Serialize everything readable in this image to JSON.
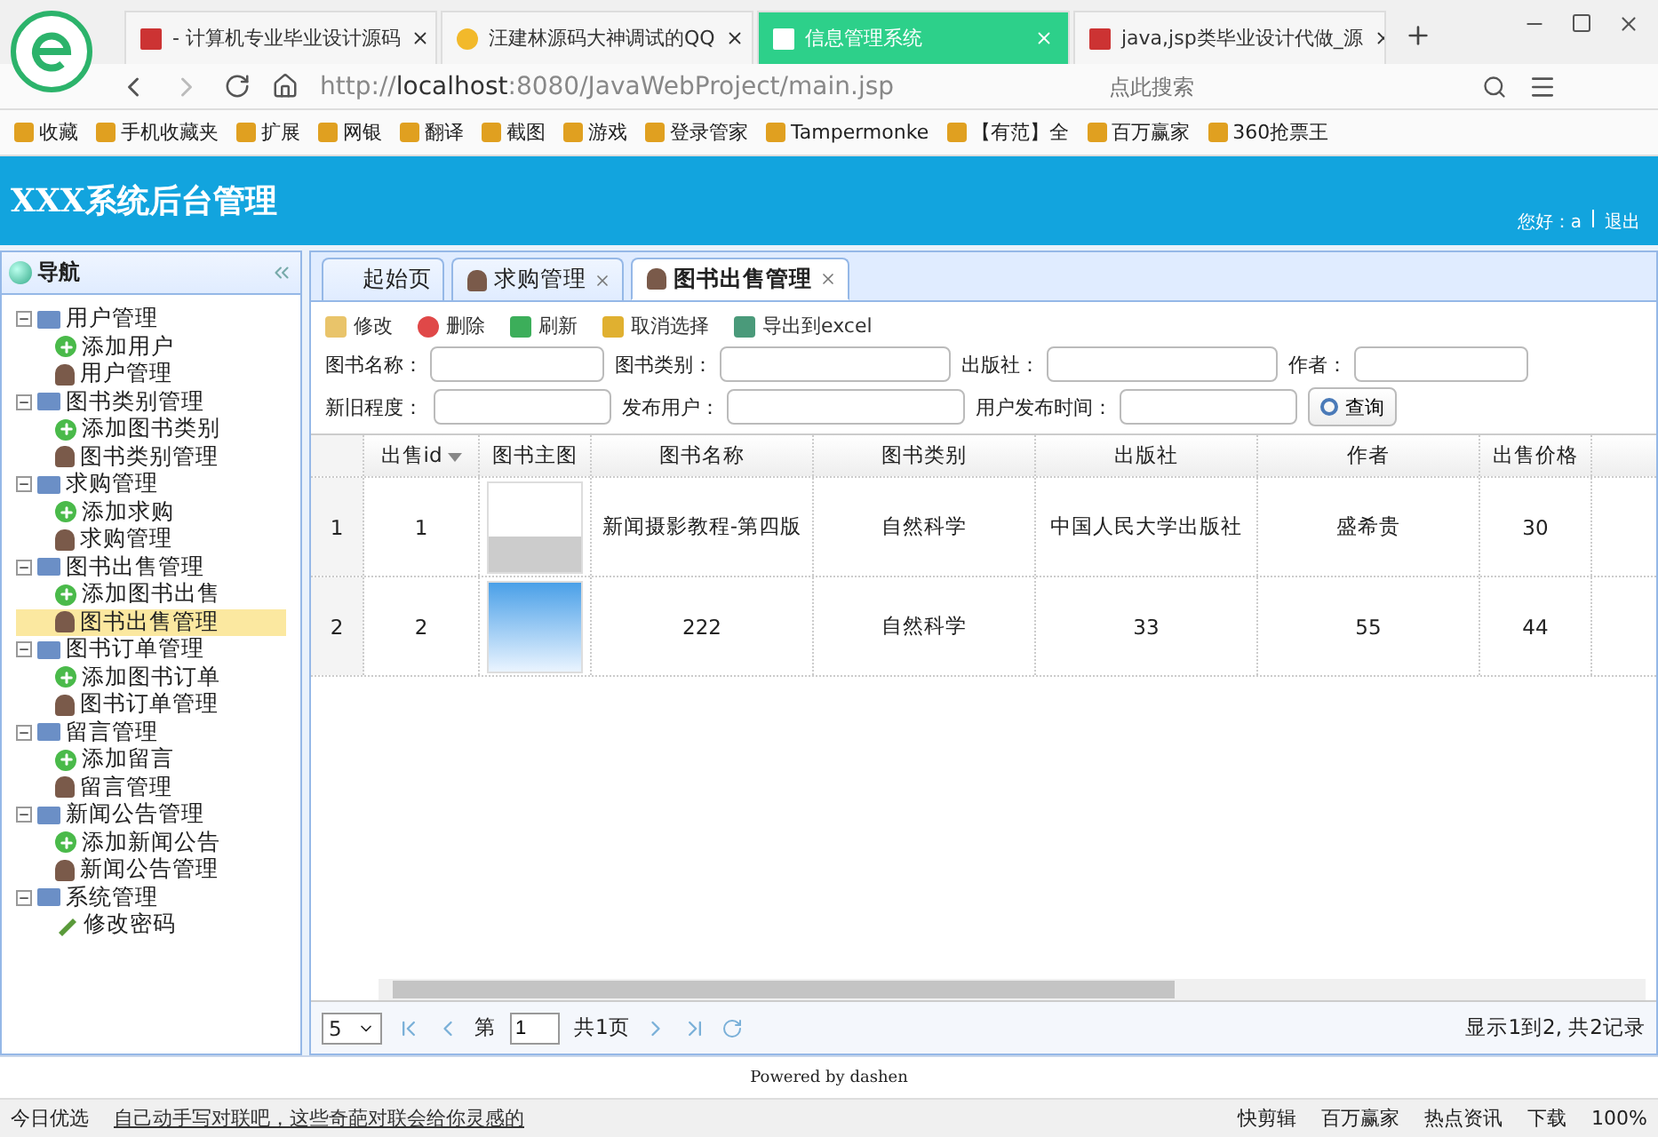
{
  "browser": {
    "tabs": [
      {
        "title": "- 计算机专业毕业设计源码",
        "selected": false,
        "kind": "flag"
      },
      {
        "title": "汪建林源码大神调试的QQ",
        "selected": false,
        "kind": "star"
      },
      {
        "title": "信息管理系统",
        "selected": true,
        "kind": "page"
      },
      {
        "title": "java,jsp类毕业设计代做_源",
        "selected": false,
        "kind": "flag"
      }
    ],
    "url_prefix": "http://",
    "url_host": "localhost",
    "url_rest": ":8080/JavaWebProject/main.jsp",
    "search_placeholder": "点此搜索",
    "bookmarks": [
      "收藏",
      "手机收藏夹",
      "扩展",
      "网银",
      "翻译",
      "截图",
      "游戏",
      "登录管家",
      "Tampermonke",
      "【有范】全",
      "百万赢家",
      "360抢票王"
    ]
  },
  "app": {
    "title": "XXX系统后台管理",
    "greeting": "您好：a",
    "logout": "退出",
    "nav_title": "导航",
    "tree": [
      {
        "label": "用户管理",
        "expanded": true,
        "children": [
          {
            "label": "添加用户",
            "kind": "add",
            "selected": false
          },
          {
            "label": "用户管理",
            "kind": "manage",
            "selected": false
          }
        ]
      },
      {
        "label": "图书类别管理",
        "expanded": true,
        "children": [
          {
            "label": "添加图书类别",
            "kind": "add",
            "selected": false
          },
          {
            "label": "图书类别管理",
            "kind": "manage",
            "selected": false
          }
        ]
      },
      {
        "label": "求购管理",
        "expanded": true,
        "children": [
          {
            "label": "添加求购",
            "kind": "add",
            "selected": false
          },
          {
            "label": "求购管理",
            "kind": "manage",
            "selected": false
          }
        ]
      },
      {
        "label": "图书出售管理",
        "expanded": true,
        "children": [
          {
            "label": "添加图书出售",
            "kind": "add",
            "selected": false
          },
          {
            "label": "图书出售管理",
            "kind": "manage",
            "selected": true
          }
        ]
      },
      {
        "label": "图书订单管理",
        "expanded": true,
        "children": [
          {
            "label": "添加图书订单",
            "kind": "add",
            "selected": false
          },
          {
            "label": "图书订单管理",
            "kind": "manage",
            "selected": false
          }
        ]
      },
      {
        "label": "留言管理",
        "expanded": true,
        "children": [
          {
            "label": "添加留言",
            "kind": "add",
            "selected": false
          },
          {
            "label": "留言管理",
            "kind": "manage",
            "selected": false
          }
        ]
      },
      {
        "label": "新闻公告管理",
        "expanded": true,
        "children": [
          {
            "label": "添加新闻公告",
            "kind": "add",
            "selected": false
          },
          {
            "label": "新闻公告管理",
            "kind": "manage",
            "selected": false
          }
        ]
      },
      {
        "label": "系统管理",
        "expanded": true,
        "children": [
          {
            "label": "修改密码",
            "kind": "edit",
            "selected": false
          }
        ]
      }
    ],
    "tabs": [
      {
        "label": "起始页",
        "selected": false,
        "closable": false
      },
      {
        "label": "求购管理",
        "selected": false,
        "closable": true
      },
      {
        "label": "图书出售管理",
        "selected": true,
        "closable": true
      }
    ],
    "toolbar": [
      {
        "label": "修改",
        "kind": "edit"
      },
      {
        "label": "删除",
        "kind": "delete"
      },
      {
        "label": "刷新",
        "kind": "refresh"
      },
      {
        "label": "取消选择",
        "kind": "undo"
      },
      {
        "label": "导出到excel",
        "kind": "export"
      }
    ],
    "filters": [
      {
        "label": "图书名称："
      },
      {
        "label": "图书类别："
      },
      {
        "label": "出版社："
      },
      {
        "label": "作者："
      },
      {
        "label": "新旧程度："
      },
      {
        "label": "发布用户："
      },
      {
        "label": "用户发布时间："
      }
    ],
    "search_button": "查询",
    "columns": [
      "出售id",
      "图书主图",
      "图书名称",
      "图书类别",
      "出版社",
      "作者",
      "出售价格"
    ],
    "rows": [
      {
        "number": "1",
        "id": "1",
        "kind": "cover",
        "name": "新闻摄影教程-第四版",
        "category": "自然科学",
        "publisher": "中国人民大学出版社",
        "author": "盛希贵",
        "price": "30"
      },
      {
        "number": "2",
        "id": "2",
        "kind": "none",
        "name": "222",
        "category": "自然科学",
        "publisher": "33",
        "author": "55",
        "price": "44"
      }
    ],
    "pager": {
      "page_size": "5",
      "page_label": "第",
      "page": "1",
      "total_pages": "共1页",
      "info": "显示1到2, 共2记录"
    },
    "footer": "Powered by dashen"
  },
  "status_bar": {
    "left": "今日优选",
    "news": "自己动手写对联吧，这些奇葩对联会给你灵感的",
    "items": [
      "快剪辑",
      "百万赢家",
      "热点资讯",
      "下载"
    ],
    "zoom": "100%"
  }
}
